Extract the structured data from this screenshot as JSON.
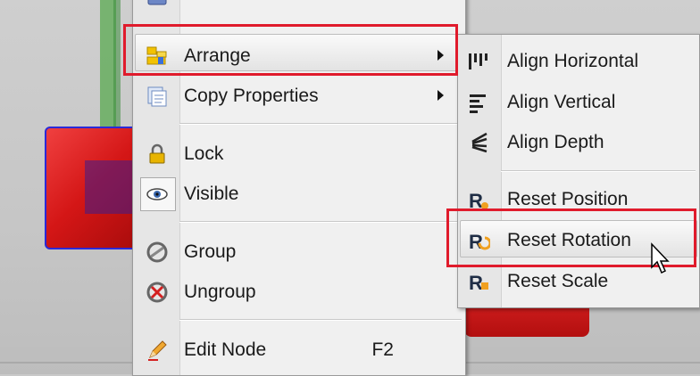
{
  "main_menu": {
    "items": [
      {
        "label": "Arrange",
        "icon": "arrange-icon",
        "has_submenu": true
      },
      {
        "label": "Copy Properties",
        "icon": "copy-properties-icon",
        "has_submenu": true
      },
      {
        "label": "Lock",
        "icon": "lock-icon"
      },
      {
        "label": "Visible",
        "icon": "eye-icon"
      },
      {
        "label": "Group",
        "icon": "group-icon"
      },
      {
        "label": "Ungroup",
        "icon": "ungroup-icon"
      },
      {
        "label": "Edit Node",
        "icon": "pencil-icon",
        "shortcut": "F2"
      }
    ]
  },
  "sub_menu": {
    "items": [
      {
        "label": "Align Horizontal",
        "icon": "align-horizontal-icon"
      },
      {
        "label": "Align Vertical",
        "icon": "align-vertical-icon"
      },
      {
        "label": "Align Depth",
        "icon": "align-depth-icon"
      },
      {
        "label": "Reset Position",
        "icon": "reset-position-icon"
      },
      {
        "label": "Reset Rotation",
        "icon": "reset-rotation-icon"
      },
      {
        "label": "Reset Scale",
        "icon": "reset-scale-icon"
      }
    ]
  },
  "colors": {
    "highlight": "#e01b2c",
    "menu_bg": "#f0f0f0"
  }
}
